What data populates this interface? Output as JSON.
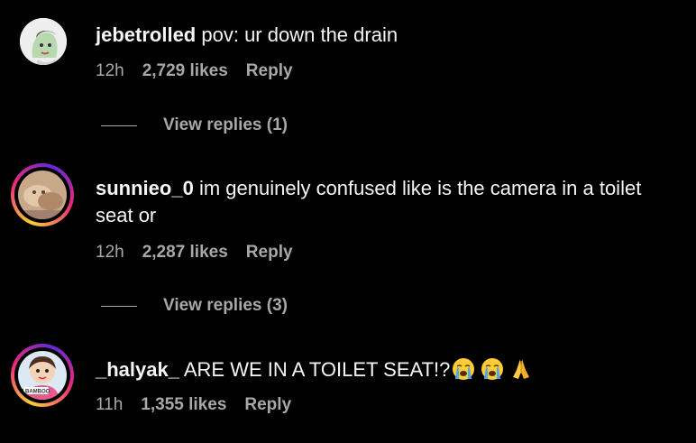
{
  "colors": {
    "background": "#000000",
    "primary_text": "#f5f5f5",
    "secondary_text": "#a8a8a8",
    "story_ring": [
      "#f9ce34",
      "#ee2a7b",
      "#6228d7"
    ]
  },
  "comments": [
    {
      "username": "jebetrolled",
      "text": "pov: ur down the drain",
      "time": "12h",
      "likes": "2,729 likes",
      "reply_label": "Reply",
      "view_replies": "View replies (1)",
      "avatar_icon": "avatar-face-mask-icon"
    },
    {
      "username": "sunnieo_0",
      "text": "im genuinely confused like is the camera in a toilet seat or",
      "time": "12h",
      "likes": "2,287 likes",
      "reply_label": "Reply",
      "view_replies": "View replies (3)",
      "avatar_icon": "avatar-photo-icon"
    },
    {
      "username": "_halyak_",
      "text": "ARE WE IN A TOILET SEAT!?",
      "emojis": [
        "loudly-crying-face-icon",
        "loudly-crying-face-icon",
        "folded-hands-icon"
      ],
      "time": "11h",
      "likes": "1,355 likes",
      "reply_label": "Reply",
      "avatar_icon": "avatar-cartoon-icon",
      "avatar_badge": "I BAMBOO"
    }
  ]
}
